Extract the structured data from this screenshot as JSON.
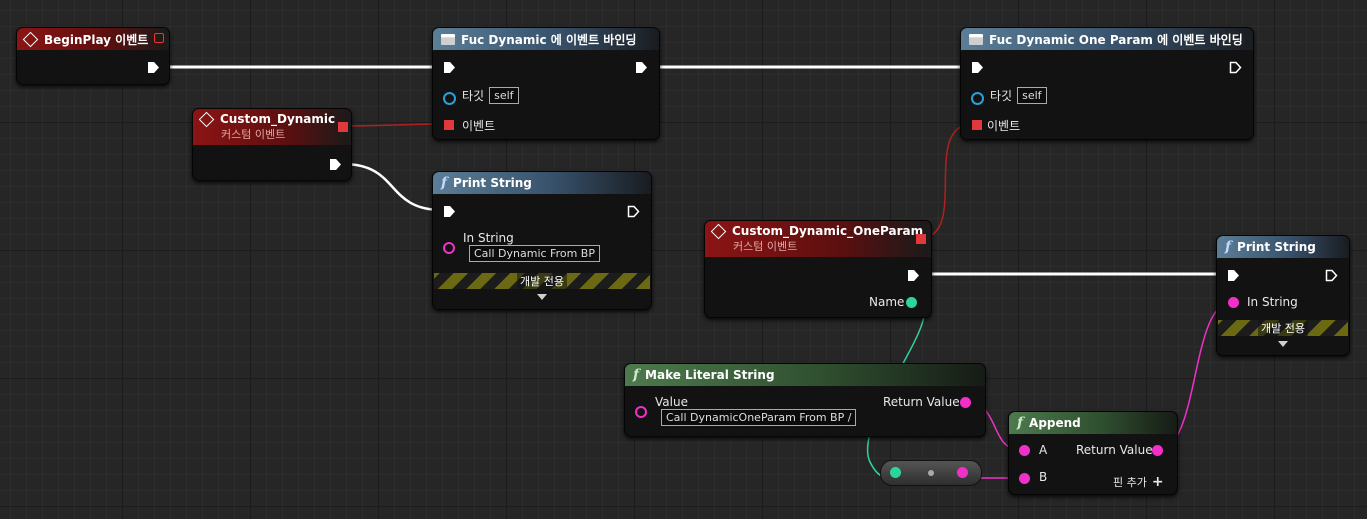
{
  "nodes": {
    "begin_play": {
      "title": "BeginPlay 이벤트"
    },
    "custom_dynamic": {
      "title": "Custom_Dynamic",
      "subtitle": "커스텀 이벤트"
    },
    "bind_fuc_dynamic": {
      "title": "Fuc Dynamic 에 이벤트 바인딩",
      "target_label": "타깃",
      "target_value": "self",
      "event_label": "이벤트"
    },
    "bind_fuc_dynamic_one_param": {
      "title": "Fuc Dynamic One Param 에 이벤트 바인딩",
      "target_label": "타깃",
      "target_value": "self",
      "event_label": "이벤트"
    },
    "print_string_1": {
      "title": "Print String",
      "in_string_label": "In String",
      "in_string_value": "Call Dynamic From BP",
      "dev_only": "개발 전용"
    },
    "custom_dynamic_one_param": {
      "title": "Custom_Dynamic_OneParam",
      "subtitle": "커스텀 이벤트",
      "name_label": "Name"
    },
    "print_string_2": {
      "title": "Print String",
      "in_string_label": "In String",
      "dev_only": "개발 전용"
    },
    "make_literal_string": {
      "title": "Make Literal String",
      "value_label": "Value",
      "value": "Call DynamicOneParam From BP /",
      "return_label": "Return Value"
    },
    "append": {
      "title": "Append",
      "a_label": "A",
      "b_label": "B",
      "return_label": "Return Value",
      "add_pin_label": "핀 추가"
    }
  },
  "colors": {
    "exec": "#ffffff",
    "delegate": "#e0393c",
    "string": "#f030c8",
    "name": "#2fd3a0",
    "object": "#2a9fd8"
  }
}
